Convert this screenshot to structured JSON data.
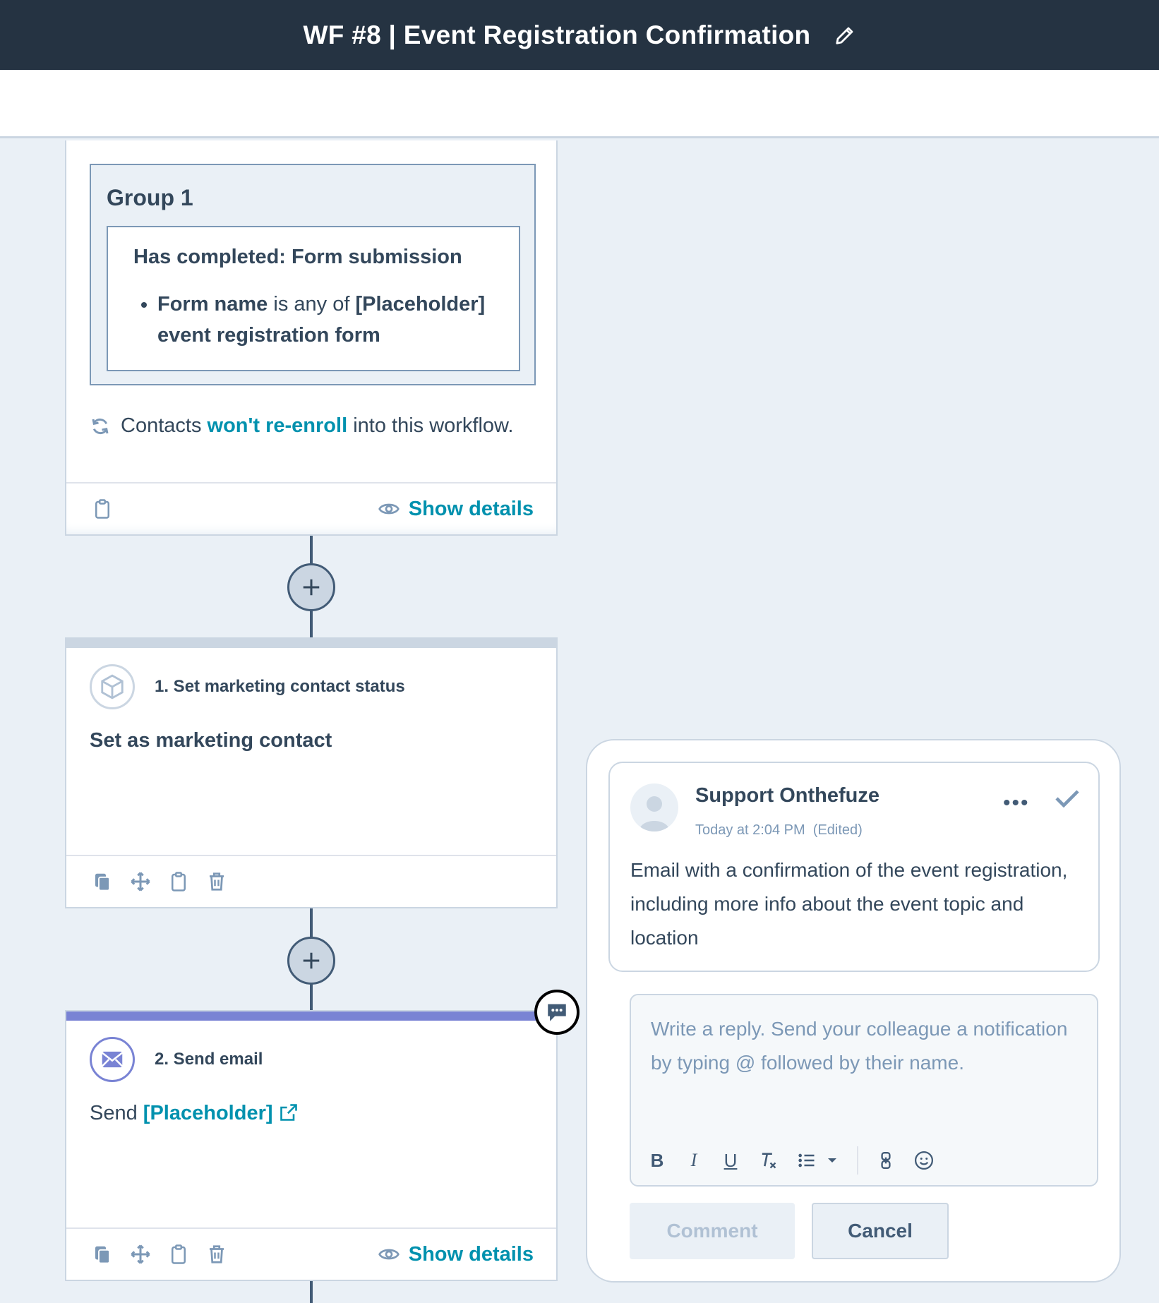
{
  "header": {
    "title": "WF #8 | Event Registration Confirmation",
    "edit_icon": "pencil-icon",
    "background": "#253342"
  },
  "trigger": {
    "group_title": "Group 1",
    "filter_title": "Has completed: Form submission",
    "filter_field": "Form name",
    "filter_operator": "is any of",
    "filter_value": "[Placeholder] event registration form",
    "reenroll_prefix": "Contacts",
    "reenroll_link": "won't re-enroll",
    "reenroll_suffix": "into this workflow.",
    "show_details": "Show details"
  },
  "actions": [
    {
      "title": "1. Set marketing contact status",
      "icon": "cube-icon",
      "description": "Set as marketing contact"
    },
    {
      "title": "2. Send email",
      "icon": "email-icon",
      "description_prefix": "Send",
      "link": "[Placeholder]",
      "show_details": "Show details",
      "accent": "#7983d4"
    }
  ],
  "comment": {
    "author": "Support Onthefuze",
    "time": "Today at 2:04 PM",
    "edited": "(Edited)",
    "body": "Email with a confirmation of the event registration, including more info about the event topic and location",
    "reply_placeholder": "Write a reply. Send your colleague a notification by typing @ followed by their name.",
    "toolbar": [
      "B",
      "I",
      "U"
    ],
    "comment_button": "Comment",
    "cancel_button": "Cancel"
  },
  "colors": {
    "link": "#0091ae",
    "text": "#33475b",
    "canvas": "#eaf0f6"
  }
}
